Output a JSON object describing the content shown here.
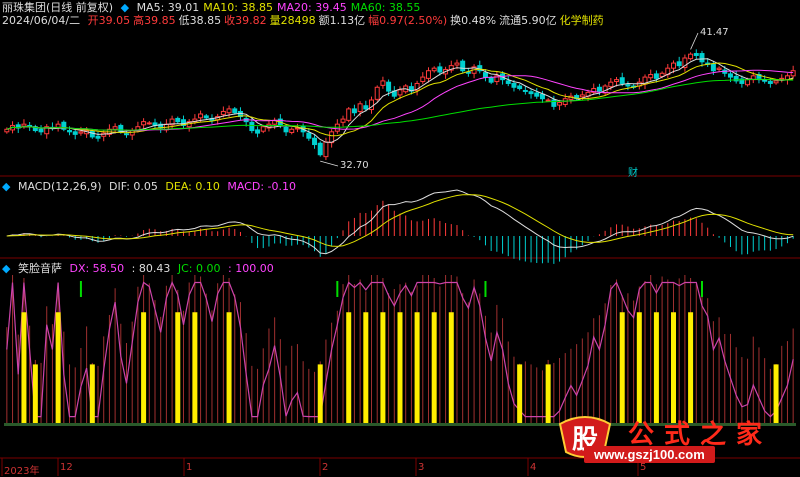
{
  "header1": {
    "stock_title": "丽珠集团(日线 前复权)",
    "ma_items": [
      {
        "label": "MA5: 39.01",
        "color": "#dddddd"
      },
      {
        "label": "MA10: 38.85",
        "color": "#e0e000"
      },
      {
        "label": "MA20: 39.45",
        "color": "#ff44ff"
      },
      {
        "label": "MA60: 38.55",
        "color": "#00dd00"
      }
    ]
  },
  "header2": {
    "date": "2024/06/04/二",
    "fields": [
      {
        "label": "开39.05",
        "color": "#ff3b3b"
      },
      {
        "label": "高39.85",
        "color": "#ff3b3b"
      },
      {
        "label": "低38.85",
        "color": "#dddddd"
      },
      {
        "label": "收39.82",
        "color": "#ff3b3b"
      },
      {
        "label": "量28498",
        "color": "#e0e000"
      },
      {
        "label": "额1.13亿",
        "color": "#dddddd"
      },
      {
        "label": "幅0.97(2.50%)",
        "color": "#ff3b3b"
      },
      {
        "label": "换0.48%",
        "color": "#dddddd"
      },
      {
        "label": "流通5.90亿",
        "color": "#dddddd"
      },
      {
        "label": "化学制药",
        "color": "#e0e000"
      }
    ]
  },
  "annotations": {
    "high_label": "41.47",
    "low_label": "32.70",
    "cai_label": "财"
  },
  "macd_header": {
    "title": "MACD(12,26,9)",
    "dif": "DIF: 0.05",
    "dea": "DEA: 0.10",
    "macd": "MACD: -0.10"
  },
  "indicator_header": {
    "title": "笑脸音萨",
    "dx": "DX: 58.50",
    "v2": ": 80.43",
    "jc": "JC: 0.00",
    "v3": ": 100.00"
  },
  "x_axis": {
    "labels": [
      "2023年",
      "12",
      "1",
      "2",
      "3",
      "4",
      "5"
    ]
  },
  "watermark": {
    "logo_text": "股",
    "site_name": "公式之家",
    "url": "www.gszj100.com"
  },
  "colors": {
    "up": "#ff3b3b",
    "down": "#00d0d0",
    "ma5": "#dddddd",
    "ma10": "#e0e000",
    "ma20": "#ff44ff",
    "ma60": "#00dd00",
    "bg": "#000000"
  },
  "chart_data": [
    {
      "type": "candlestick",
      "name": "price",
      "ylim": [
        32,
        43
      ],
      "annotations": [
        {
          "label": "41.47",
          "value": 41.47
        },
        {
          "label": "32.70",
          "value": 32.7
        }
      ],
      "close": [
        35.2,
        35.5,
        35.3,
        35.6,
        35.4,
        35.1,
        35.0,
        35.4,
        35.3,
        35.6,
        35.2,
        35.0,
        34.8,
        35.0,
        35.1,
        34.6,
        34.5,
        34.9,
        35.2,
        35.4,
        35.0,
        34.8,
        35.1,
        35.4,
        35.8,
        35.7,
        35.5,
        35.3,
        35.6,
        36.0,
        35.8,
        35.5,
        35.8,
        36.0,
        36.4,
        36.1,
        35.9,
        36.2,
        36.6,
        36.8,
        36.5,
        36.2,
        35.8,
        35.1,
        34.9,
        35.4,
        35.6,
        35.9,
        35.5,
        35.0,
        35.2,
        35.3,
        35.0,
        34.5,
        34.0,
        33.2,
        34.2,
        35.0,
        35.6,
        36.0,
        36.8,
        36.5,
        37.2,
        36.8,
        37.5,
        38.5,
        39.0,
        38.2,
        37.8,
        38.3,
        38.6,
        38.2,
        38.8,
        39.3,
        39.8,
        40.0,
        39.7,
        39.9,
        40.2,
        40.4,
        39.8,
        39.6,
        40.1,
        39.8,
        39.3,
        38.9,
        39.4,
        39.1,
        38.8,
        38.5,
        38.4,
        38.2,
        38.0,
        37.8,
        37.6,
        37.5,
        37.0,
        37.3,
        37.6,
        37.8,
        37.6,
        37.9,
        38.1,
        38.4,
        38.2,
        38.6,
        38.9,
        39.1,
        38.8,
        38.6,
        38.5,
        38.9,
        39.3,
        39.5,
        39.2,
        39.6,
        40.0,
        40.4,
        40.2,
        40.8,
        41.1,
        41.0,
        40.5,
        40.3,
        39.8,
        40.0,
        39.6,
        39.3,
        39.0,
        38.8,
        39.1,
        39.4,
        39.2,
        39.0,
        38.8,
        39.0,
        39.2,
        39.4,
        39.8
      ]
    },
    {
      "type": "line",
      "name": "MACD",
      "series": [
        "DIF",
        "DEA",
        "MACD"
      ],
      "values_text": {
        "DIF": 0.05,
        "DEA": 0.1,
        "MACD": -0.1
      }
    },
    {
      "type": "bar",
      "name": "笑脸音萨",
      "series": [
        "DX",
        "JC"
      ],
      "values_text": {
        "DX": 58.5,
        "v2": 80.43,
        "JC": 0.0,
        "v3": 100.0
      }
    }
  ]
}
